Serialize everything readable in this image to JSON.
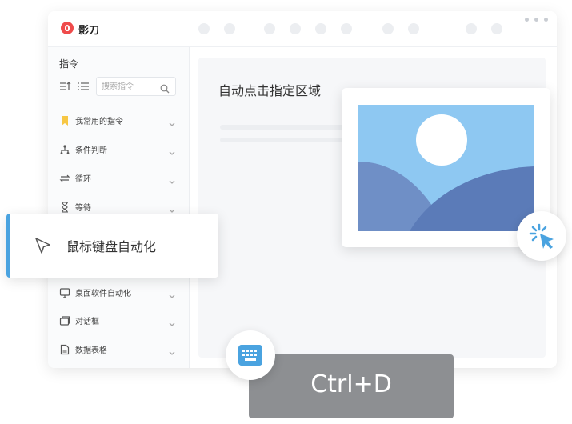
{
  "app": {
    "name": "影刀"
  },
  "sidebar": {
    "title": "指令",
    "search_placeholder": "搜索指令",
    "categories": [
      {
        "label": "我常用的指令",
        "icon": "bookmark-icon"
      },
      {
        "label": "条件判断",
        "icon": "branch-icon"
      },
      {
        "label": "循环",
        "icon": "loop-icon"
      },
      {
        "label": "等待",
        "icon": "hourglass-icon"
      },
      {
        "label": "鼠标键盘自动化",
        "icon": "cursor-icon"
      },
      {
        "label": "桌面软件自动化",
        "icon": "monitor-icon"
      },
      {
        "label": "对话框",
        "icon": "dialog-icon"
      },
      {
        "label": "数据表格",
        "icon": "sheet-icon"
      }
    ]
  },
  "main": {
    "title": "自动点击指定区域"
  },
  "shortcut": {
    "keys": "Ctrl+D"
  },
  "colors": {
    "accent": "#4aa3e0",
    "logo": "#ef4b4b",
    "shortcut_bg": "#8d8f92",
    "sky": "#8ec8f2",
    "hill_front": "#5b7bb8"
  }
}
